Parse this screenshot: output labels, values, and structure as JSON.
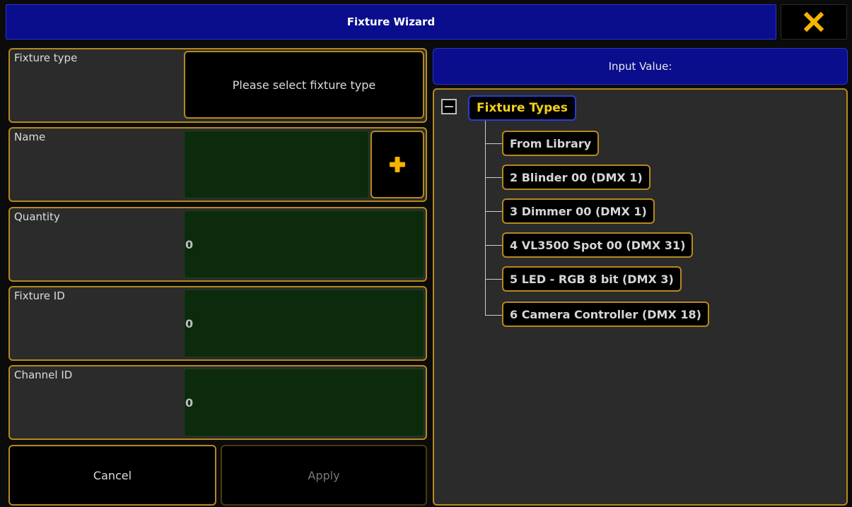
{
  "window": {
    "title": "Fixture Wizard"
  },
  "form": {
    "fixture_type": {
      "label": "Fixture type",
      "button_text": "Please select fixture type"
    },
    "name": {
      "label": "Name",
      "value": ""
    },
    "quantity": {
      "label": "Quantity",
      "value": "0"
    },
    "fixture_id": {
      "label": "Fixture ID",
      "value": "0"
    },
    "channel_id": {
      "label": "Channel ID",
      "value": "0"
    }
  },
  "buttons": {
    "cancel": "Cancel",
    "apply": "Apply"
  },
  "input_panel": {
    "header": "Input Value:"
  },
  "tree": {
    "root": "Fixture Types",
    "children": [
      "From Library",
      "2 Blinder 00 (DMX 1)",
      "3 Dimmer 00 (DMX 1)",
      "4 VL3500 Spot 00 (DMX 31)",
      "5 LED - RGB 8 bit (DMX 3)",
      "6 Camera Controller (DMX 18)"
    ]
  },
  "colors": {
    "title_bar": "#0a0e8c",
    "border_accent": "#b58a1c",
    "field_green": "#0c2a0c",
    "root_text": "#f2d21a",
    "close_icon": "#f4b400",
    "plus_icon": "#f4b400"
  },
  "icons": {
    "close": "close-icon",
    "plus": "plus-icon",
    "collapse": "collapse-icon"
  }
}
